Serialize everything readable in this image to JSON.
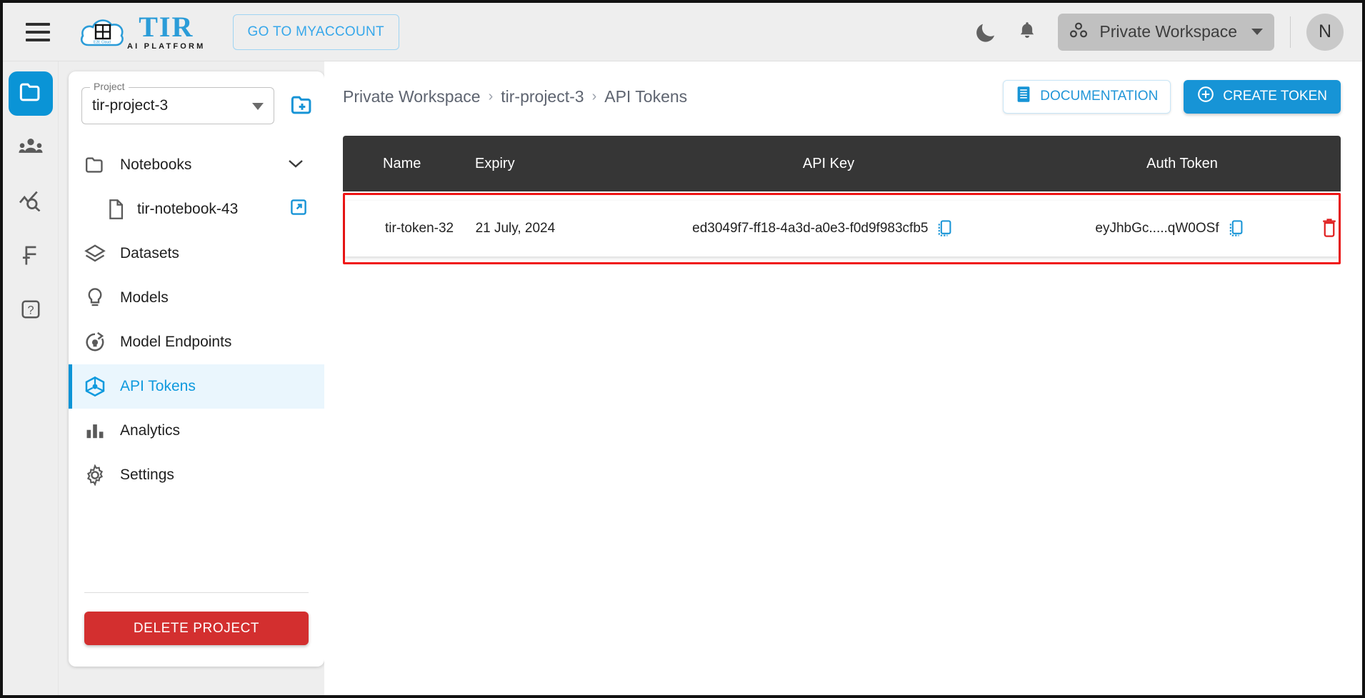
{
  "header": {
    "menu_icon": "hamburger-icon",
    "brand_name": "TIR",
    "brand_tagline": "AI PLATFORM",
    "myaccount_label": "GO TO MYACCOUNT",
    "theme_icon": "moon-icon",
    "notifications_icon": "bell-icon",
    "workspace_label": "Private Workspace",
    "workspace_icon": "workspace-dots-icon",
    "avatar_initial": "N"
  },
  "rail": {
    "items": [
      {
        "icon": "folder-icon",
        "name": "projects",
        "active": true
      },
      {
        "icon": "people-icon",
        "name": "team",
        "active": false
      },
      {
        "icon": "chart-search-icon",
        "name": "monitoring",
        "active": false
      },
      {
        "icon": "rupee-icon",
        "name": "billing",
        "active": false
      },
      {
        "icon": "help-icon",
        "name": "help",
        "active": false
      }
    ]
  },
  "sidebar": {
    "project_label": "Project",
    "project_value": "tir-project-3",
    "new_folder_icon": "folder-plus-icon",
    "items": [
      {
        "label": "Notebooks",
        "icon": "folder-outline-icon",
        "trailing_icon": "chevron-down-icon",
        "active": false
      },
      {
        "label": "Datasets",
        "icon": "layers-icon",
        "active": false
      },
      {
        "label": "Models",
        "icon": "lightbulb-icon",
        "active": false
      },
      {
        "label": "Model Endpoints",
        "icon": "endpoint-icon",
        "active": false
      },
      {
        "label": "API Tokens",
        "icon": "cube-icon",
        "active": true
      },
      {
        "label": "Analytics",
        "icon": "bar-chart-icon",
        "active": false
      },
      {
        "label": "Settings",
        "icon": "gear-icon",
        "active": false
      }
    ],
    "notebook_child": {
      "label": "tir-notebook-43",
      "icon": "file-icon",
      "trailing_icon": "external-link-icon"
    },
    "delete_label": "DELETE PROJECT"
  },
  "main": {
    "breadcrumb": [
      "Private Workspace",
      "tir-project-3",
      "API Tokens"
    ],
    "breadcrumb_separator": "›",
    "documentation_label": "DOCUMENTATION",
    "documentation_icon": "document-icon",
    "create_token_label": "CREATE TOKEN",
    "create_token_icon": "plus-circle-icon",
    "table": {
      "columns": [
        "Name",
        "Expiry",
        "API Key",
        "Auth Token"
      ],
      "rows": [
        {
          "name": "tir-token-32",
          "expiry": "21 July, 2024",
          "api_key": "ed3049f7-ff18-4a3d-a0e3-f0d9f983cfb5",
          "auth_token": "eyJhbGc.....qW0OSf",
          "copy_icon": "copy-icon",
          "delete_icon": "trash-icon",
          "highlighted": true
        }
      ]
    }
  },
  "colors": {
    "accent": "#0a94d6",
    "accent_light": "#eaf6fd",
    "danger": "#d32f2f",
    "highlight_outline": "#f01616",
    "table_header_bg": "#363636",
    "chrome_bg": "#eeeeee"
  }
}
